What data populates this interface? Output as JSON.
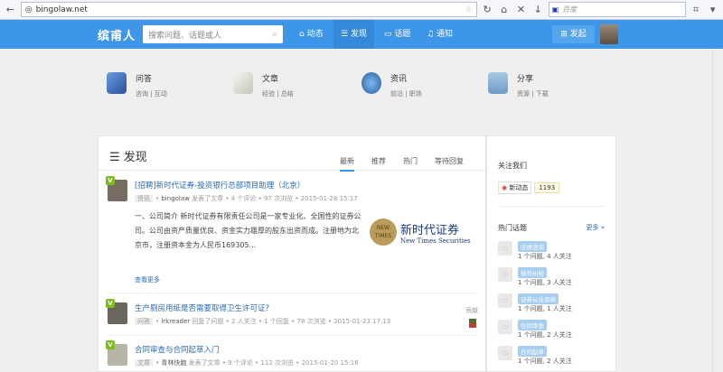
{
  "browser": {
    "url": "bingolaw.net",
    "search_placeholder": "百度"
  },
  "nav": {
    "logo": "缤甫人",
    "search_placeholder": "搜索问题、话题或人",
    "items": [
      {
        "label": "动态",
        "icon": "home-icon"
      },
      {
        "label": "发现",
        "icon": "list-icon",
        "active": true
      },
      {
        "label": "话题",
        "icon": "chat-icon"
      },
      {
        "label": "通知",
        "icon": "bell-icon"
      }
    ],
    "post": "发起"
  },
  "categories": [
    {
      "title": "问答",
      "sub": "咨询 | 互动"
    },
    {
      "title": "文章",
      "sub": "经验 | 总结"
    },
    {
      "title": "资讯",
      "sub": "前沿 | 职场"
    },
    {
      "title": "分享",
      "sub": "资源 | 下载"
    }
  ],
  "main": {
    "title": "发现",
    "tabs": [
      "最新",
      "推荐",
      "热门",
      "等待回复"
    ],
    "items": [
      {
        "title": "[招聘]新时代证券-投资银行总部项目助理（北京）",
        "tag": "资讯",
        "user": "bingolaw",
        "meta": "发表了文章 • 4 个评论 • 97 次浏览 • 2015-01-28 15:17",
        "desc": "一、公司简介 新时代证券有限责任公司是一家专业化、全国性的证券公司。公司由资产质量优良、资金实力雄厚的股东出资而成。注册地为北京市，注册资本金为人民币169305...",
        "logo_cn": "新时代证券",
        "logo_en": "New Times Securities",
        "logo_seal": "NEW TIMES",
        "more": "查看更多"
      },
      {
        "title": "生产厕房用纸是否需要取得卫生许可证？",
        "tag": "问答",
        "user": "lrkreader",
        "meta": "回复了问题 • 2 人关注 • 1 个回复 • 78 次浏览 • 2015-01-23 17:13",
        "side": "贡献"
      },
      {
        "title": "合同审查与合同起草入门",
        "tag": "文章",
        "user": "青林快跑",
        "meta": "发表了文章 • 9 个评论 • 112 次浏览 • 2015-01-20 15:16"
      }
    ]
  },
  "sidebar": {
    "follow_title": "关注我们",
    "weibo": "新动态",
    "weibo_count": "1193",
    "hot_title": "热门话题",
    "more": "更多 »",
    "topics": [
      {
        "tag": "法律咨询",
        "stats": "1 个问题, 4 人关注"
      },
      {
        "tag": "借贷纠纷",
        "stats": "1 个问题, 3 人关注"
      },
      {
        "tag": "证券从业资格",
        "stats": "1 个问题, 1 人关注"
      },
      {
        "tag": "合同审查",
        "stats": "1 个问题, 2 人关注"
      },
      {
        "tag": "合同起草",
        "stats": "1 个问题, 2 人关注"
      }
    ]
  }
}
